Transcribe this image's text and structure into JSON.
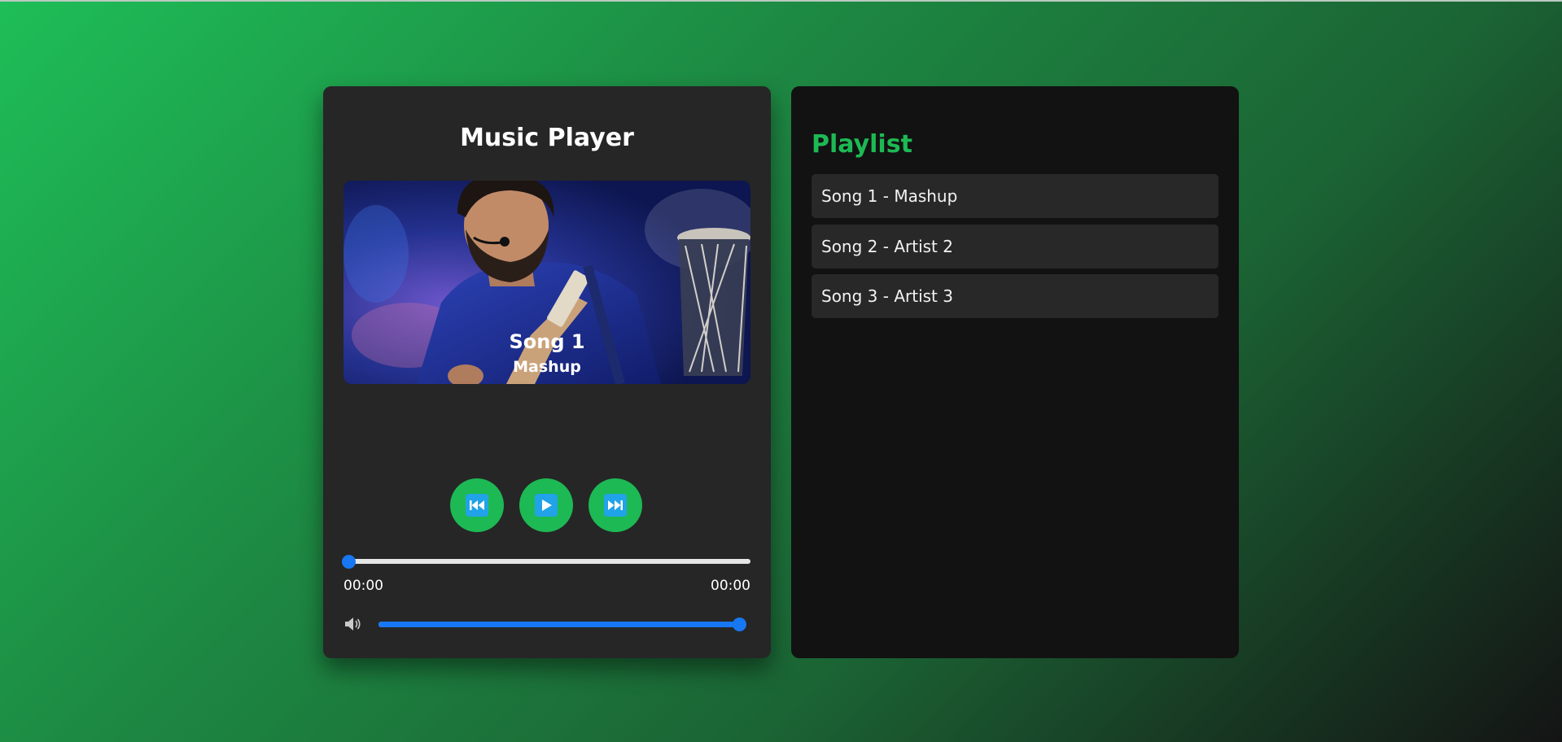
{
  "player": {
    "title": "Music Player",
    "song_title": "Song 1",
    "song_artist": "Mashup",
    "current_time": "00:00",
    "total_time": "00:00",
    "progress_fraction": 0.0,
    "volume_fraction": 1.0,
    "controls": {
      "prev_icon": "skip-previous-icon",
      "play_icon": "play-icon",
      "next_icon": "skip-next-icon"
    },
    "volume_icon": "speaker-icon"
  },
  "playlist": {
    "title": "Playlist",
    "items": [
      {
        "label": "Song 1 - Mashup"
      },
      {
        "label": "Song 2 - Artist 2"
      },
      {
        "label": "Song 3 - Artist 3"
      }
    ]
  },
  "colors": {
    "accent_green": "#1db954",
    "slider_blue": "#1877f2",
    "card_dark": "#262626",
    "playlist_bg": "#121212"
  }
}
